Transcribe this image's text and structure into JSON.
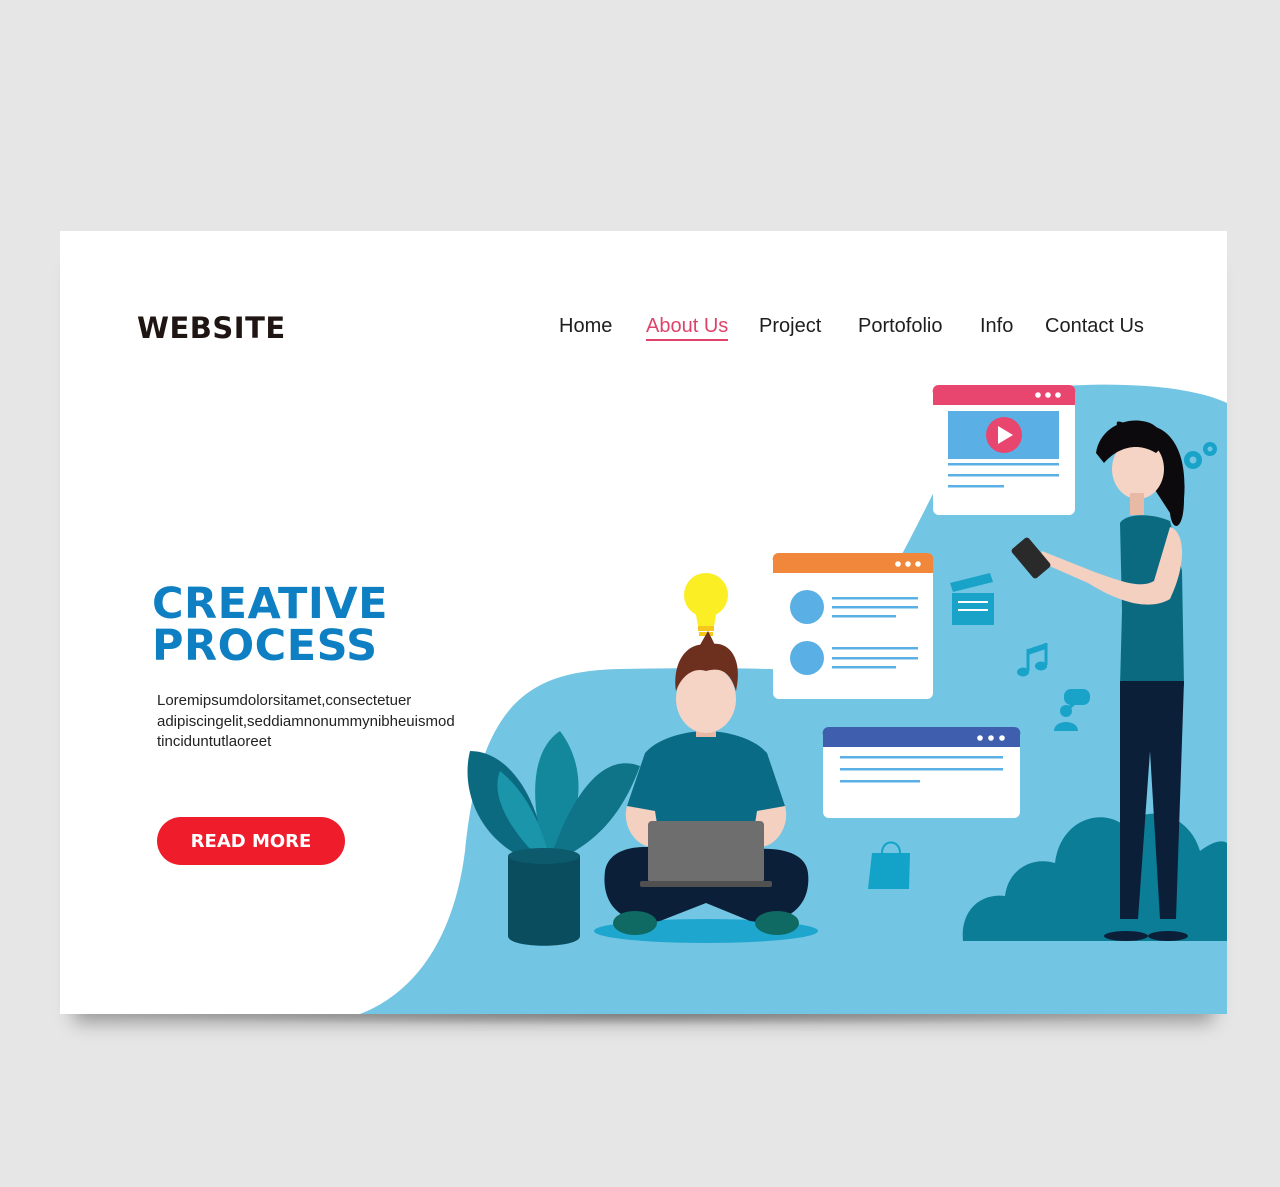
{
  "brand": {
    "logo_text": "WEBSITE"
  },
  "nav": {
    "items": [
      {
        "label": "Home"
      },
      {
        "label": "About Us",
        "active": true
      },
      {
        "label": "Project"
      },
      {
        "label": "Portofolio"
      },
      {
        "label": "Info"
      },
      {
        "label": "Contact Us"
      }
    ]
  },
  "hero": {
    "title_line1": "CREATIVE",
    "title_line2": "PROCESS",
    "body_lines": [
      "Loremipsumdolorsitamet,consectetuer",
      "adipiscingelit,seddiamnonummynibheuismod",
      "tinciduntutlaoreet"
    ],
    "cta_label": "READ MORE"
  },
  "colors": {
    "page_bg": "#e6e6e6",
    "card_bg": "#ffffff",
    "accent_blue": "#0d7fc2",
    "nav_active": "#e0436a",
    "cta_red": "#ef1c2c",
    "wave_blue": "#72c5e3",
    "teal_dark": "#0b6a80"
  },
  "illustration": {
    "icons": [
      "lightbulb-icon",
      "video-window-icon",
      "list-window-icon",
      "text-window-icon",
      "gear-icon",
      "clapperboard-icon",
      "music-note-icon",
      "chat-user-icon",
      "shopping-bag-icon",
      "plant",
      "bush"
    ]
  }
}
